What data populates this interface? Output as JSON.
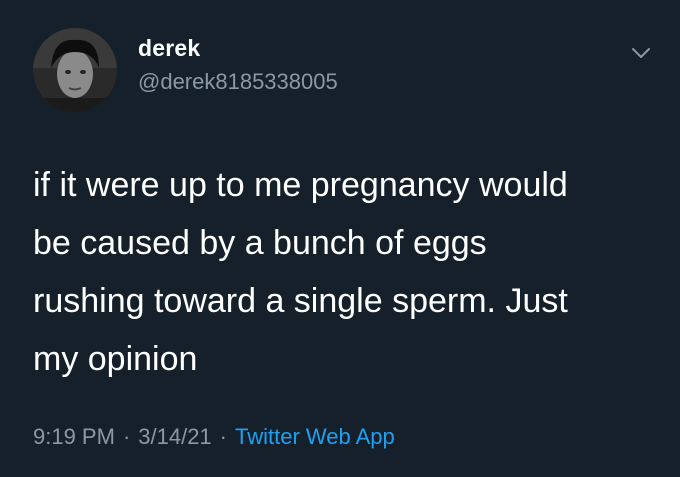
{
  "tweet": {
    "author": {
      "display_name": "derek",
      "handle": "@derek8185338005",
      "avatar_icon": "profile-photo"
    },
    "menu_icon": "chevron-down-icon",
    "text": "if it were up to me pregnancy would\nbe caused by a bunch of eggs\nrushing toward a single sperm. Just\nmy opinion",
    "time": "9:19 PM",
    "date": "3/14/21",
    "source": "Twitter Web App",
    "separator": "·"
  },
  "colors": {
    "background": "#15202b",
    "primary_text": "#ffffff",
    "secondary_text": "#8b98a5",
    "link": "#1da1f2"
  }
}
